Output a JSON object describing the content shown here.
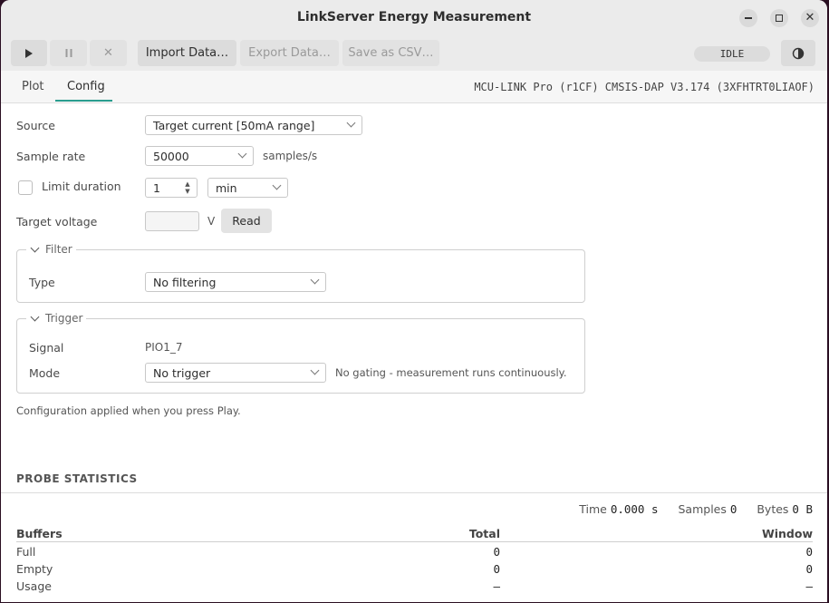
{
  "window": {
    "title": "LinkServer Energy Measurement"
  },
  "toolbar": {
    "import_label": "Import Data…",
    "export_label": "Export Data…",
    "save_csv_label": "Save as CSV…",
    "status": "IDLE"
  },
  "tabs": [
    {
      "label": "Plot"
    },
    {
      "label": "Config",
      "active": true
    }
  ],
  "probe_info": "MCU-LINK Pro (r1CF) CMSIS-DAP V3.174 (3XFHTRT0LIAOF)",
  "config": {
    "source_label": "Source",
    "source_value": "Target current [50mA range]",
    "sample_rate_label": "Sample rate",
    "sample_rate_value": "50000",
    "sample_rate_unit": "samples/s",
    "limit_duration_label": "Limit duration",
    "limit_duration_checked": false,
    "duration_value": "1",
    "duration_unit": "min",
    "target_voltage_label": "Target voltage",
    "target_voltage_value": "",
    "voltage_unit": "V",
    "read_label": "Read",
    "filter": {
      "title": "Filter",
      "type_label": "Type",
      "type_value": "No filtering"
    },
    "trigger": {
      "title": "Trigger",
      "signal_label": "Signal",
      "signal_value": "PIO1_7",
      "mode_label": "Mode",
      "mode_value": "No trigger",
      "mode_note": "No gating - measurement runs continuously."
    },
    "footer_note": "Configuration applied when you press Play."
  },
  "stats": {
    "title": "PROBE STATISTICS",
    "time_label": "Time",
    "time_value": "0.000 s",
    "samples_label": "Samples",
    "samples_value": "0",
    "bytes_label": "Bytes",
    "bytes_value": "0 B",
    "columns": {
      "name": "Buffers",
      "total": "Total",
      "window": "Window"
    },
    "rows": [
      {
        "name": "Full",
        "total": "0",
        "window": "0"
      },
      {
        "name": "Empty",
        "total": "0",
        "window": "0"
      },
      {
        "name": "Usage",
        "total": "–",
        "window": "–"
      }
    ]
  },
  "colors": {
    "accent": "#2a9d8f",
    "titlebar": "#ebebeb",
    "background": "#ffffff"
  }
}
